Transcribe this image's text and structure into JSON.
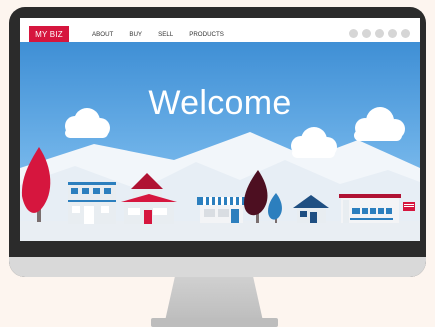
{
  "logo_text": "MY BIZ",
  "nav": {
    "links": [
      "ABOUT",
      "BUY",
      "SELL",
      "PRODUCTS"
    ]
  },
  "hero": {
    "title": "Welcome"
  },
  "colors": {
    "brand_red": "#d6163e",
    "sky_blue": "#3f8fd5",
    "nav_bg": "#ffffff",
    "dot_gray": "#d6d6d6"
  },
  "icons": [
    "cloud-icon",
    "tree-icon",
    "house-icon",
    "shop-icon",
    "gas-station-icon"
  ]
}
